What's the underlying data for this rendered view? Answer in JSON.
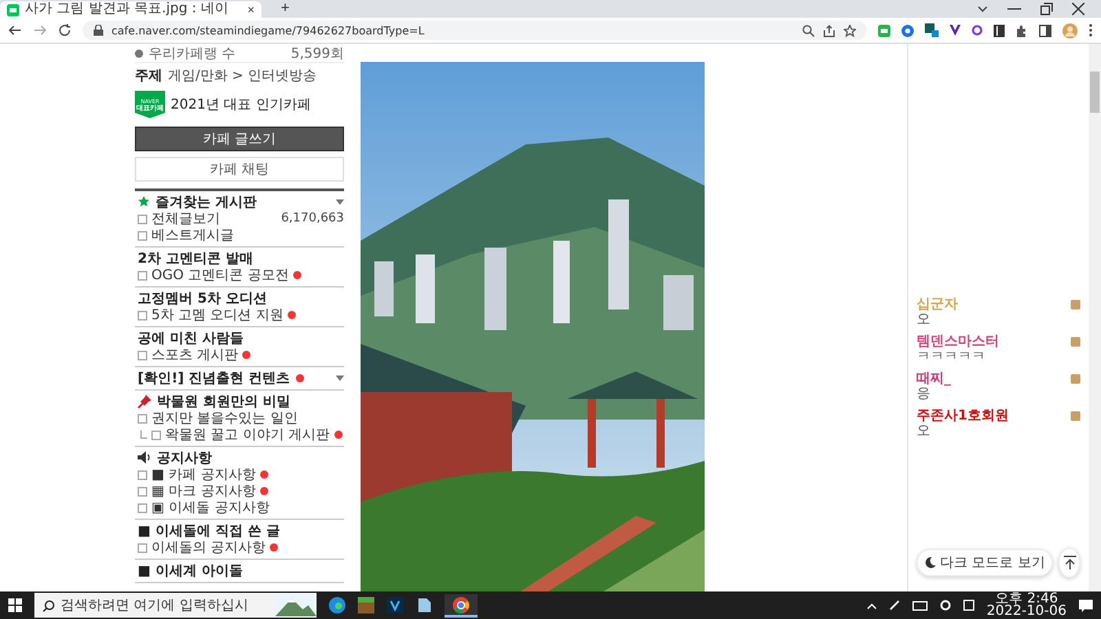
{
  "browser": {
    "tab": {
      "title": "사가 그림 발견과 목표.jpg : 네이",
      "close": "×"
    },
    "new_tab": "+",
    "url": "cafe.naver.com/steamindiegame/79462627boardType=L"
  },
  "cafe_sidebar": {
    "member_rank": {
      "label": "우리카페랭 수",
      "value": "5,599회"
    },
    "topic": {
      "label": "주제",
      "value": "게임/만화 > 인터넷방송"
    },
    "badge": {
      "top": "NAVER",
      "bottom": "대표카페"
    },
    "award": "2021년 대표 인기카페",
    "write_button": "카페 글쓰기",
    "chat_button": "카페 채팅",
    "sections": [
      {
        "kind": "favorites",
        "title": "즐겨찾는 게시판",
        "expandable": true,
        "new": false,
        "items": [
          {
            "label": "전체글보기",
            "count": "6,170,663",
            "new": false
          },
          {
            "label": "베스트게시글",
            "new": false
          }
        ]
      },
      {
        "kind": "plain",
        "title": "2차 고멘티콘 발매",
        "expandable": false,
        "new": false,
        "items": [
          {
            "label": "OGO 고멘티콘 공모전",
            "new": true
          }
        ]
      },
      {
        "kind": "plain",
        "title": "고정멤버 5차 오디션",
        "expandable": false,
        "new": false,
        "items": [
          {
            "label": "5차 고멤 오디션 지원",
            "new": true
          }
        ]
      },
      {
        "kind": "plain",
        "title": "공에 미친 사람들",
        "expandable": false,
        "new": false,
        "items": [
          {
            "label": "스포츠 게시판",
            "new": true
          }
        ]
      },
      {
        "kind": "plain",
        "title": "[확인!] 진념출현 컨텐츠",
        "expandable": true,
        "new": true
      },
      {
        "kind": "pinned",
        "title": "박물원 회원만의 비밀",
        "expandable": false,
        "new": false,
        "items": [
          {
            "label": "권지만 볼을수있는 일인",
            "new": false,
            "children": [
              {
                "label": "왁물원 꿀고 이야기 게시판",
                "new": true
              }
            ]
          }
        ]
      },
      {
        "kind": "notice",
        "title": "공지사항",
        "expandable": false,
        "new": false,
        "items": [
          {
            "label": "■ 카페 공지사항",
            "new": true
          },
          {
            "label": "▦ 마크 공지사항",
            "new": true
          },
          {
            "label": "▣ 이세돌 공지사항",
            "new": false
          }
        ]
      },
      {
        "kind": "plain",
        "title": "■ 이세돌에 직접 쓴 글",
        "expandable": false,
        "new": false,
        "items": [
          {
            "label": "이세돌의 공지사항",
            "new": true
          }
        ]
      },
      {
        "kind": "plain",
        "title": "■ 이세계 아이돌",
        "expandable": false,
        "new": false
      }
    ]
  },
  "chat": [
    {
      "name": "십군자",
      "color": "#d4a84f",
      "message": "오"
    },
    {
      "name": "템덴스마스터",
      "color": "#d2457e",
      "message": "ㅋㅋㅋㅋㅋ"
    },
    {
      "name": "때찌_",
      "color": "#c8407e",
      "message": "응"
    },
    {
      "name": "주존사1호회원",
      "color": "#cc1111",
      "message": "오"
    }
  ],
  "dark_mode_button": "다크 모드로 보기",
  "taskbar": {
    "search_placeholder": "검색하려면 여기에 입력하십시",
    "time": "오후 2:46",
    "date": "2022-10-06"
  }
}
